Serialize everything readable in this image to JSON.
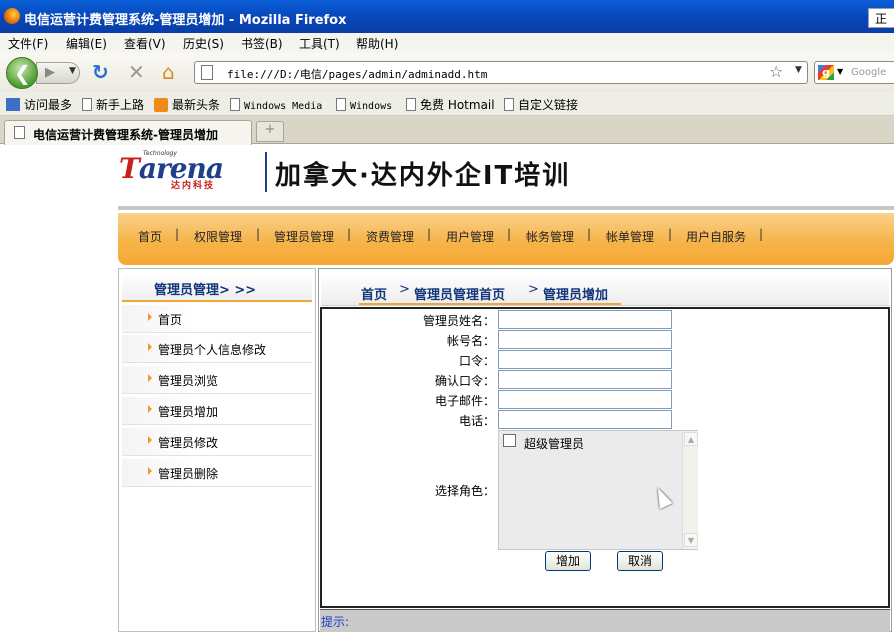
{
  "window": {
    "title": "电信运营计费管理系统-管理员增加 - Mozilla Firefox",
    "corner_text": "正在"
  },
  "menu": [
    "文件(F)",
    "编辑(E)",
    "查看(V)",
    "历史(S)",
    "书签(B)",
    "工具(T)",
    "帮助(H)"
  ],
  "url": "file:///D:/电信/pages/admin/adminadd.htm",
  "search_placeholder": "Google",
  "bookmarks": [
    "访问最多",
    "新手上路",
    "最新头条",
    "Windows Media",
    "Windows",
    "免费 Hotmail",
    "自定义链接"
  ],
  "tab": {
    "title": "电信运营计费管理系统-管理员增加",
    "new_tab": "+"
  },
  "brand": {
    "tagline_small": "Technology",
    "logo_main": "arena",
    "logo_first": "T",
    "logo_sub": "达内科技",
    "slogan": "加拿大·达内外企IT培训"
  },
  "nav": [
    "首页",
    "权限管理",
    "管理员管理",
    "资费管理",
    "用户管理",
    "帐务管理",
    "帐单管理",
    "用户自服务"
  ],
  "sidebar": {
    "heading": "管理员管理>  >>",
    "items": [
      "首页",
      "管理员个人信息修改",
      "管理员浏览",
      "管理员增加",
      "管理员修改",
      "管理员删除"
    ]
  },
  "breadcrumb": {
    "home": "首页",
    "section": "管理员管理首页",
    "current": "管理员增加",
    "chevron": ">"
  },
  "form": {
    "labels": [
      "管理员姓名：",
      "帐号名：",
      "口令：",
      "确认口令：",
      "电子邮件：",
      "电话："
    ],
    "values": [
      "",
      "",
      "",
      "",
      "",
      ""
    ],
    "role_label": "选择角色：",
    "roles": [
      "超级管理员"
    ],
    "add_button": "增加",
    "cancel_button": "取消"
  },
  "hint_label": "提示:",
  "colors": {
    "accent_orange": "#f5a832",
    "brand_blue": "#13357a",
    "title_blue": "#0846b8"
  }
}
